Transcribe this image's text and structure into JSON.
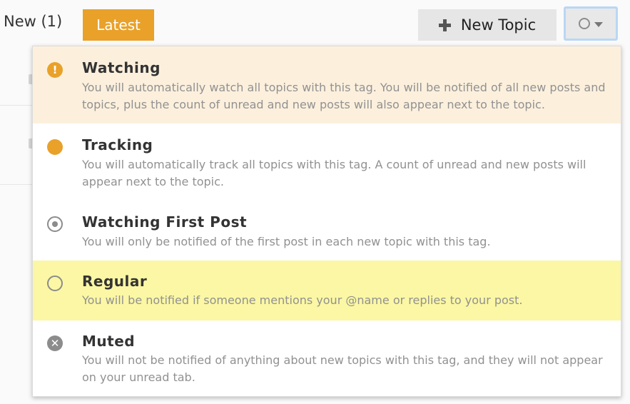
{
  "nav": {
    "new_label": "New (1)",
    "latest_label": "Latest"
  },
  "toolbar": {
    "new_topic_label": "New Topic",
    "notification_icon": "circle-outline-icon"
  },
  "colors": {
    "accent": "#e9a12a",
    "watching_bg": "#fcf0dd",
    "regular_bg": "#fbf7a4",
    "muted_text": "#919191"
  },
  "notification_menu": {
    "options": [
      {
        "icon": "exclamation-circle-icon",
        "title": "Watching",
        "description": "You will automatically watch all topics with this tag. You will be notified of all new posts and topics, plus the count of unread and new posts will also appear next to the topic."
      },
      {
        "icon": "filled-circle-icon",
        "title": "Tracking",
        "description": "You will automatically track all topics with this tag. A count of unread and new posts will appear next to the topic."
      },
      {
        "icon": "dot-circle-icon",
        "title": "Watching First Post",
        "description": "You will only be notified of the first post in each new topic with this tag."
      },
      {
        "icon": "circle-outline-icon",
        "title": "Regular",
        "description": "You will be notified if someone mentions your @name or replies to your post."
      },
      {
        "icon": "times-circle-icon",
        "title": "Muted",
        "description": "You will not be notified of anything about new topics with this tag, and they will not appear on your unread tab."
      }
    ]
  }
}
